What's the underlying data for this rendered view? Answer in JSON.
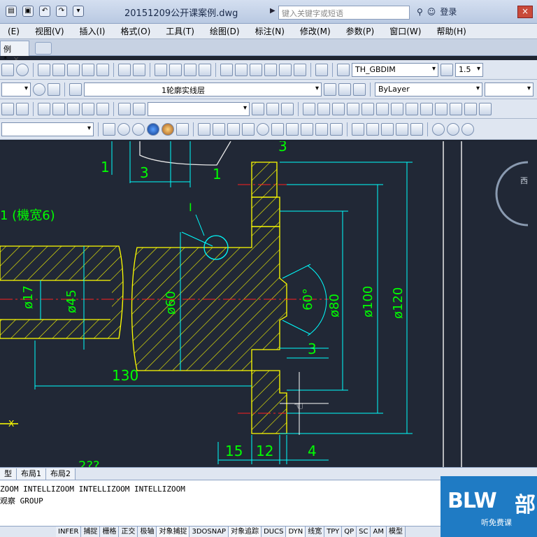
{
  "window": {
    "title": "20151209公开课案例.dwg",
    "search_placeholder": "键入关键字或短语",
    "login_label": "登录",
    "close_glyph": "×"
  },
  "menu": [
    "(E)",
    "视图(V)",
    "插入(I)",
    "格式(O)",
    "工具(T)",
    "绘图(D)",
    "标注(N)",
    "修改(M)",
    "参数(P)",
    "窗口(W)",
    "帮助(H)"
  ],
  "document_tab": {
    "label": "例*",
    "close_glyph": "×"
  },
  "toolbar": {
    "dimstyle_value": "TH_GBDIM",
    "textheight_value": "1.5",
    "layer_value": "1轮廓实线层",
    "color_value": "ByLayer"
  },
  "drawing": {
    "dims": {
      "d17": "ø17",
      "d45": "ø45",
      "d60": "ø60",
      "d80": "ø80",
      "d100": "ø100",
      "d120": "ø120",
      "angle": "60°",
      "len130": "130",
      "len15": "15",
      "len12": "12",
      "len4": "4",
      "top3": "3",
      "top1a": "1",
      "top1b": "1",
      "top3b": "3",
      "right3": "3",
      "leader_label": "I",
      "left_note": "1 (機宽6)",
      "partial": "2??"
    },
    "colors": {
      "line": "#ffff00",
      "dim": "#00ffff",
      "text": "#00ff00",
      "center": "#ff2020",
      "bg": "#212836"
    },
    "compass_label": "西"
  },
  "layout_tabs": [
    "型",
    "布局1",
    "布局2"
  ],
  "command_lines": [
    "ZOOM INTELLIZOOM INTELLIZOOM INTELLIZOOM",
    "观察 GROUP"
  ],
  "status": [
    "INFER",
    "捕捉",
    "栅格",
    "正交",
    "极轴",
    "对象捕捉",
    "3DOSNAP",
    "对象追踪",
    "DUCS",
    "DYN",
    "线宽",
    "TPY",
    "QP",
    "SC",
    "AM",
    "模型"
  ],
  "watermark": {
    "brand": "BLW",
    "char": "部",
    "sub": "听免费课"
  }
}
